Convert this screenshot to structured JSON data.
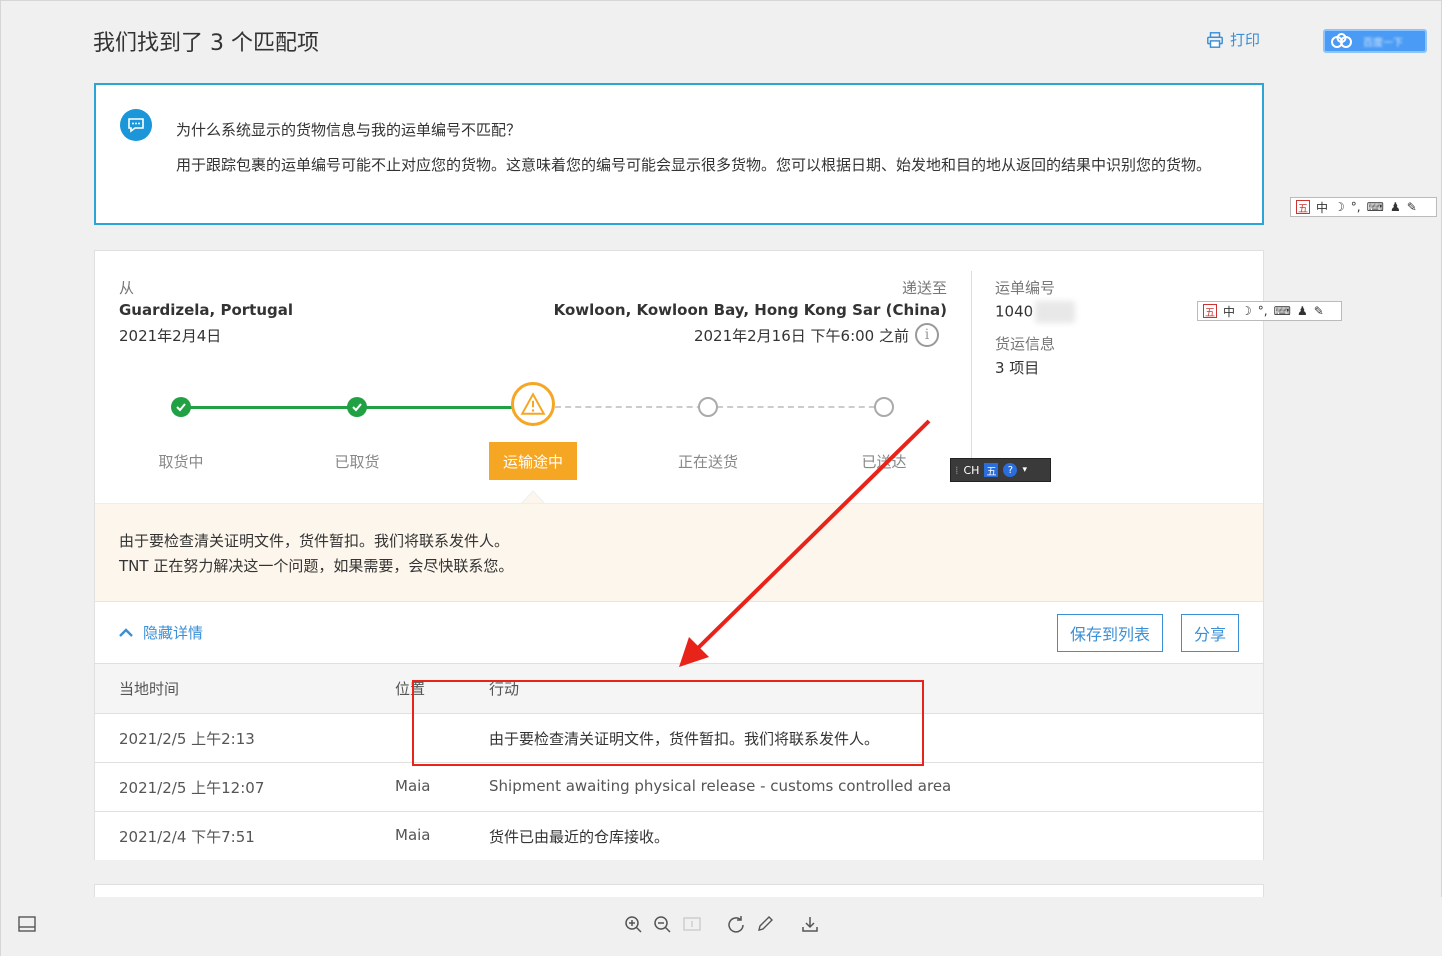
{
  "header": {
    "title": "我们找到了 3 个匹配项",
    "print_label": "打印"
  },
  "baidu": {
    "label": "百度一下"
  },
  "info": {
    "question": "为什么系统显示的货物信息与我的运单编号不匹配？",
    "answer": "用于跟踪包裹的运单编号可能不止对应您的货物。这意味着您的编号可能会显示很多货物。您可以根据日期、始发地和目的地从返回的结果中识别您的货物。"
  },
  "shipment": {
    "from_label": "从",
    "from_place": "Guardizela, Portugal",
    "from_date": "2021年2月4日",
    "to_label": "递送至",
    "to_place": "Kowloon, Kowloon Bay, Hong Kong Sar (China)",
    "to_date": "2021年2月16日 下午6:00 之前",
    "info_glyph": "i",
    "waybill_label": "运单编号",
    "waybill_value": "1040",
    "cargo_label": "货运信息",
    "cargo_value": "3 项目"
  },
  "progress": {
    "steps": [
      "取货中",
      "已取货",
      "运输途中",
      "正在送货",
      "已送达"
    ],
    "active_index": 2,
    "done_color": "#22a144",
    "active_color": "#f5a623"
  },
  "notice": {
    "line1": "由于要检查清关证明文件，货件暂扣。我们将联系发件人。",
    "line2": "TNT 正在努力解决这一个问题，如果需要，会尽快联系您。"
  },
  "actions": {
    "hide_details": "隐藏详情",
    "save_to_list": "保存到列表",
    "share": "分享"
  },
  "table": {
    "headers": [
      "当地时间",
      "位置",
      "行动"
    ],
    "rows": [
      {
        "time": "2021/2/5 上午2:13",
        "location": "",
        "action": "由于要检查清关证明文件，货件暂扣。我们将联系发件人。"
      },
      {
        "time": "2021/2/5 上午12:07",
        "location": "Maia",
        "action": "Shipment awaiting physical release - customs controlled area"
      },
      {
        "time": "2021/2/4 下午7:51",
        "location": "Maia",
        "action": "货件已由最近的仓库接收。"
      }
    ]
  },
  "ime": {
    "wu": "五",
    "zhong": "中",
    "ch": "CH",
    "help": "?"
  },
  "annotation_color": "#e8231a"
}
